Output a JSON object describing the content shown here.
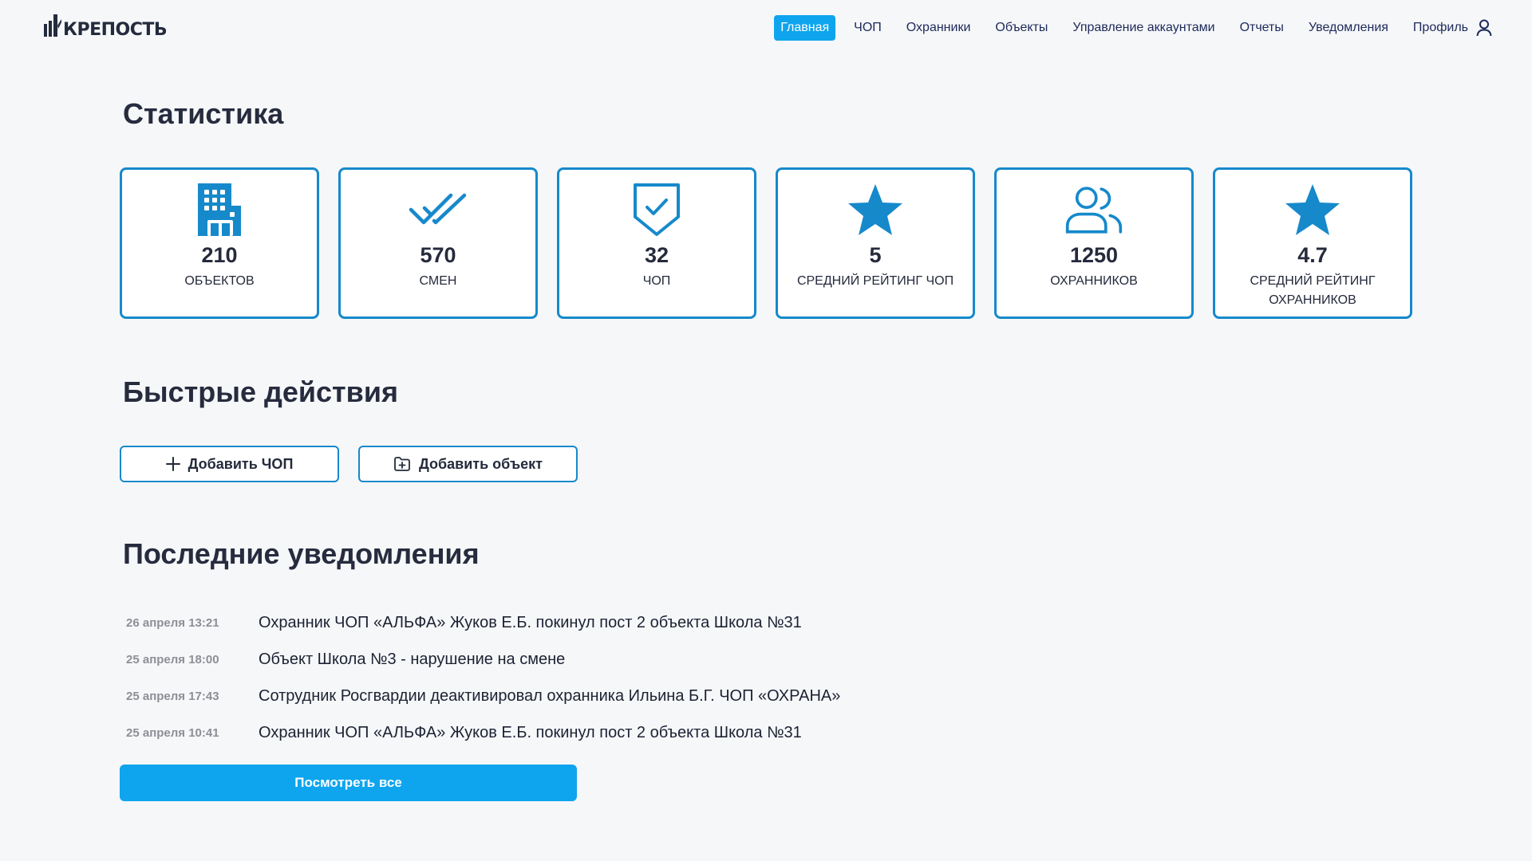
{
  "brand": {
    "name": "КРЕПОСТЬ"
  },
  "nav": {
    "items": [
      {
        "label": "Главная",
        "active": true
      },
      {
        "label": "ЧОП"
      },
      {
        "label": "Охранники"
      },
      {
        "label": "Объекты"
      },
      {
        "label": "Управление аккаунтами"
      },
      {
        "label": "Отчеты"
      },
      {
        "label": "Уведомления"
      }
    ],
    "profile": {
      "label": "Профиль",
      "icon": "user-icon"
    }
  },
  "stats": {
    "title": "Статистика",
    "cards": [
      {
        "value": "210",
        "label": "ОБЪЕКТОВ",
        "icon": "building-icon"
      },
      {
        "value": "570",
        "label": "СМЕН",
        "icon": "double-check-icon"
      },
      {
        "value": "32",
        "label": "ЧОП",
        "icon": "shield-check-icon"
      },
      {
        "value": "5",
        "label": "СРЕДНИЙ РЕЙТИНГ ЧОП",
        "icon": "star-icon"
      },
      {
        "value": "1250",
        "label": "ОХРАННИКОВ",
        "icon": "users-icon"
      },
      {
        "value": "4.7",
        "label": "СРЕДНИЙ РЕЙТИНГ ОХРАННИКОВ",
        "icon": "star-icon"
      }
    ]
  },
  "quick_actions": {
    "title": "Быстрые действия",
    "buttons": [
      {
        "label": "Добавить ЧОП",
        "icon": "plus-icon"
      },
      {
        "label": "Добавить объект",
        "icon": "folder-add-icon"
      }
    ]
  },
  "notifications": {
    "title": "Последние уведомления",
    "items": [
      {
        "date": "26 апреля 13:21",
        "text": "Охранник ЧОП «АЛЬФА» Жуков Е.Б. покинул пост 2 объекта Школа №31"
      },
      {
        "date": "25 апреля 18:00",
        "text": "Объект Школа №3 - нарушение на смене"
      },
      {
        "date": "25 апреля 17:43",
        "text": "Сотрудник Росгвардии деактивировал охранника Ильина Б.Г. ЧОП «ОХРАНА»"
      },
      {
        "date": "25 апреля 10:41",
        "text": "Охранник ЧОП «АЛЬФА» Жуков Е.Б. покинул пост 2 объекта Школа №31"
      }
    ],
    "view_all_label": "Посмотреть все"
  },
  "colors": {
    "accent": "#0ea5ee",
    "card_border": "#1689cb",
    "icon": "#1689cb",
    "background": "#f6f7f9"
  }
}
